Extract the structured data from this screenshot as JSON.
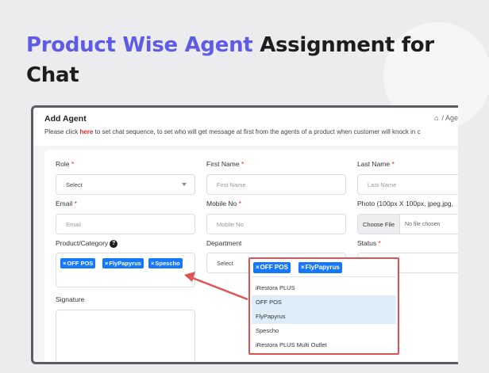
{
  "headline": {
    "accent": "Product Wise Agent",
    "rest": "Assignment for Chat"
  },
  "page": {
    "title": "Add Agent",
    "breadcrumb": "/ Age",
    "notice_prefix": "Please click ",
    "notice_link": "here",
    "notice_suffix": " to set chat sequence, to set who will get message at first from the agents of a product when customer will knock in c"
  },
  "form": {
    "role": {
      "label": "Role",
      "required": "*",
      "value": "Select"
    },
    "first_name": {
      "label": "First Name",
      "required": "*",
      "placeholder": "First Name"
    },
    "last_name": {
      "label": "Last Name",
      "required": "*",
      "placeholder": "Last Name"
    },
    "email": {
      "label": "Email",
      "required": "*",
      "placeholder": "Email"
    },
    "mobile": {
      "label": "Mobile No",
      "required": "*",
      "placeholder": "Mobile No"
    },
    "photo": {
      "label": "Photo (100px X 100px, jpeg,jpg,",
      "button": "Choose File",
      "status": "No file chosen"
    },
    "product": {
      "label": "Product/Category",
      "tags": [
        "OFF POS",
        "FlyPapyrus",
        "Spescho"
      ]
    },
    "department": {
      "label": "Department",
      "value": "Select"
    },
    "status": {
      "label": "Status",
      "required": "*"
    },
    "signature": {
      "label": "Signature"
    }
  },
  "dropdown": {
    "tags": [
      "OFF POS",
      "FlyPapyrus"
    ],
    "options": [
      {
        "label": "iRestora PLUS",
        "selected": false
      },
      {
        "label": "OFF POS",
        "selected": true
      },
      {
        "label": "FlyPapyrus",
        "selected": true
      },
      {
        "label": "Spescho",
        "selected": false
      },
      {
        "label": "iRestora PLUS Multi Outlet",
        "selected": false
      }
    ]
  },
  "colors": {
    "accent": "#5e5ce6",
    "tag": "#1677ff",
    "highlight": "#e05252",
    "required": "#e4262c"
  },
  "icons": {
    "home": "home-icon",
    "help": "question-circle-icon",
    "remove": "x-icon",
    "caret": "chevron-down-icon"
  }
}
